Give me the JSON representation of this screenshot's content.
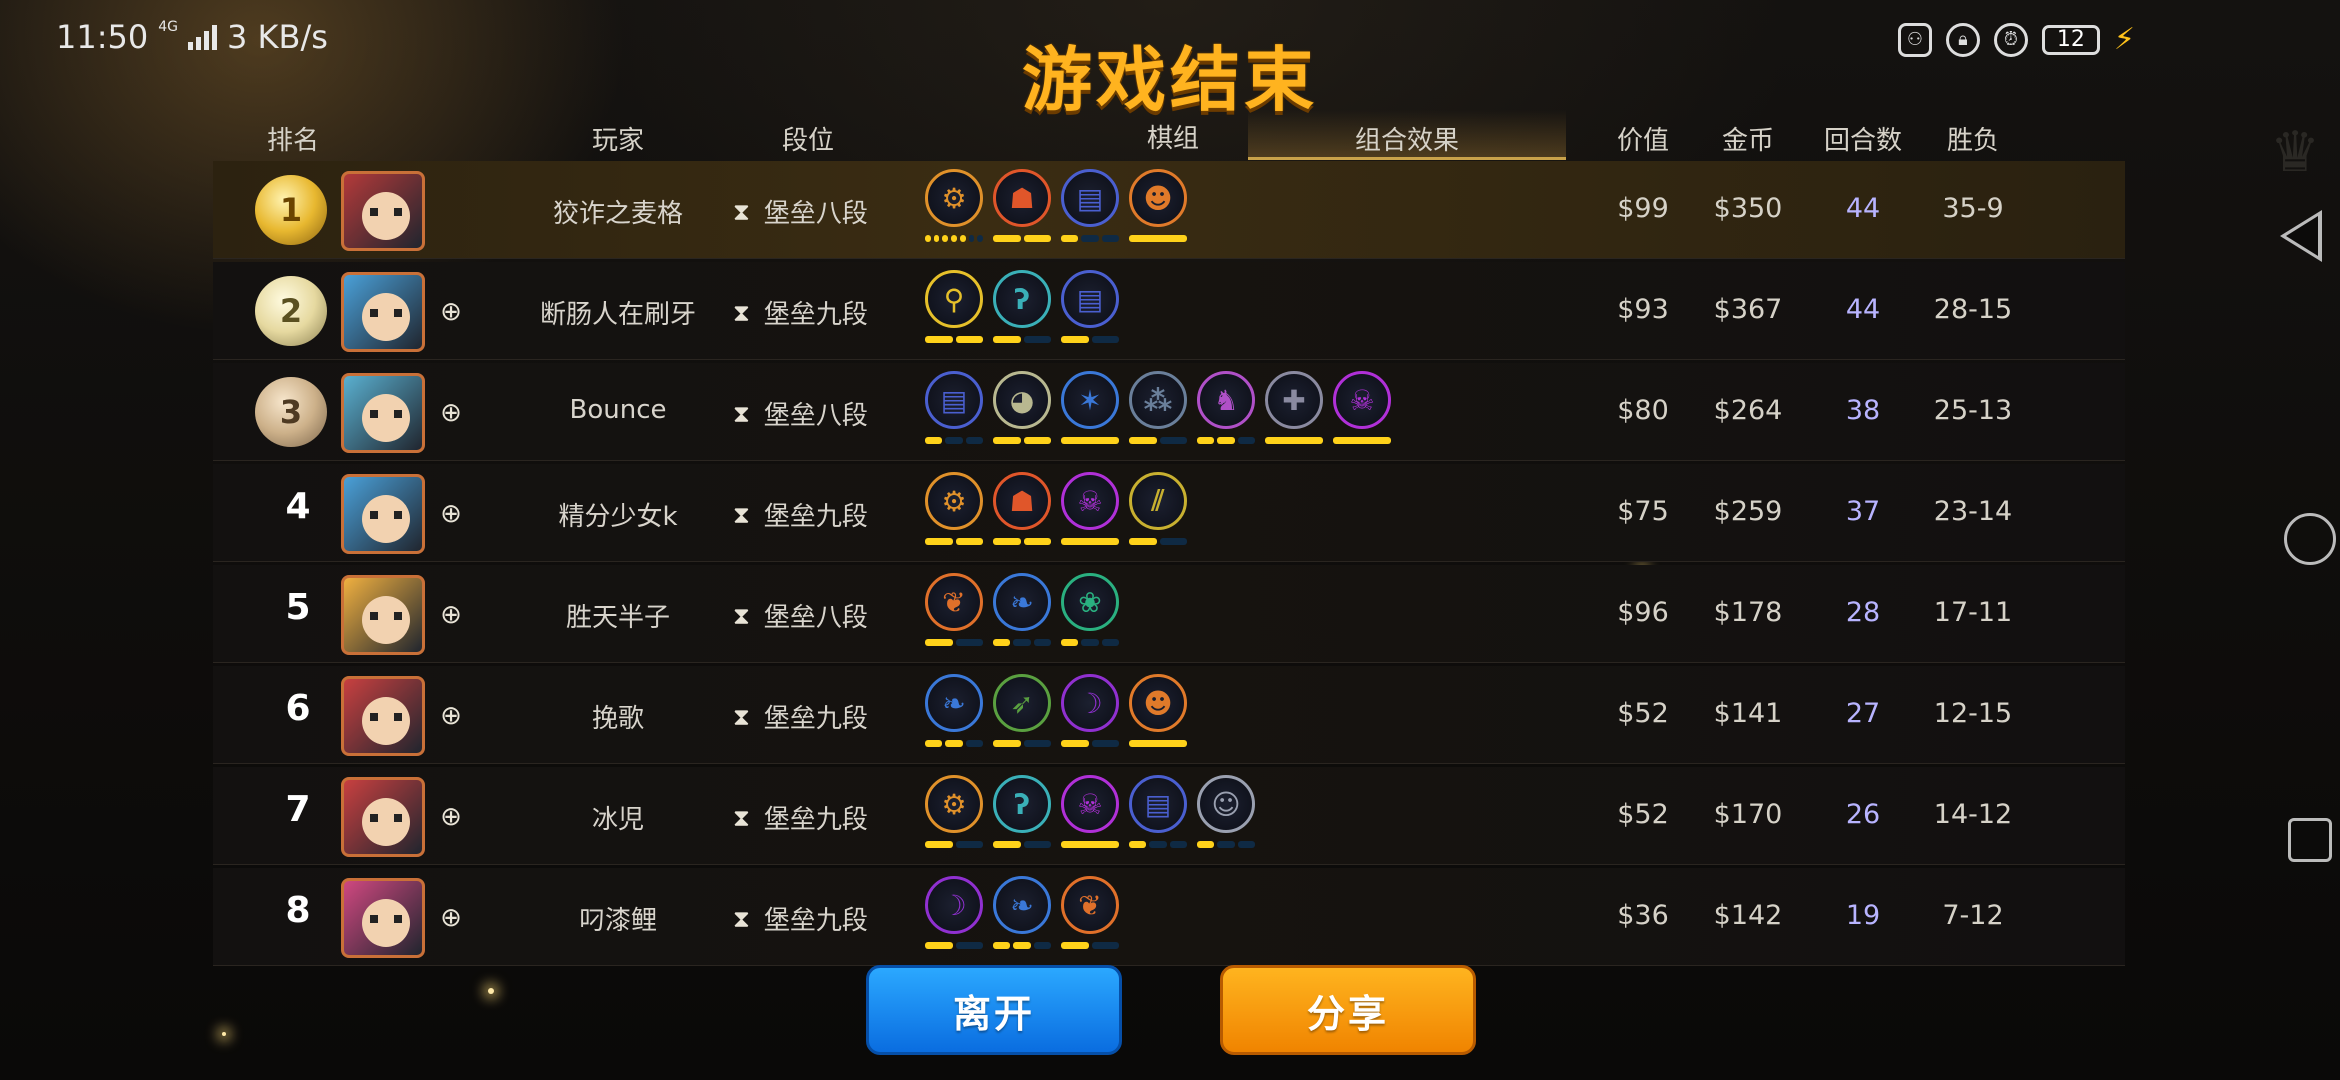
{
  "status_bar": {
    "time": "11:50",
    "network": "4G",
    "speed": "3 KB/s",
    "battery": "12",
    "icons": [
      "game-controller-icon",
      "lock-rotation-icon",
      "alarm-icon"
    ]
  },
  "title": "游戏结束",
  "columns": {
    "rank": "排名",
    "player": "玩家",
    "tier": "段位",
    "board": "棋组",
    "synergy": "组合效果",
    "value": "价值",
    "gold": "金币",
    "rounds": "回合数",
    "record": "胜负"
  },
  "players": [
    {
      "rank": "1",
      "medal": "gold",
      "name": "狡诈之麦格",
      "tier": "堡垒八段",
      "value": "$99",
      "gold": "$350",
      "rounds": "44",
      "record": "35-9",
      "avatar_color": "#b33a3a",
      "self": true,
      "synergies": [
        {
          "icon": "gear-icon",
          "color": "#e0912a",
          "bars": [
            1,
            1,
            1,
            1,
            1,
            0,
            0
          ]
        },
        {
          "icon": "orc-icon",
          "color": "#e0562a",
          "bars": [
            1,
            1
          ]
        },
        {
          "icon": "book-icon",
          "color": "#4a5fd0",
          "bars": [
            1,
            0,
            0
          ]
        },
        {
          "icon": "viking-icon",
          "color": "#e07a2a",
          "bars": [
            1
          ]
        }
      ]
    },
    {
      "rank": "2",
      "medal": "silver",
      "name": "断肠人在刷牙",
      "tier": "堡垒九段",
      "value": "$93",
      "gold": "$367",
      "rounds": "44",
      "record": "28-15",
      "avatar_color": "#4aa0d8",
      "self": false,
      "synergies": [
        {
          "icon": "keyhole-icon",
          "color": "#e6c02a",
          "bars": [
            1,
            1
          ]
        },
        {
          "icon": "hook-icon",
          "color": "#3ab0b8",
          "bars": [
            1,
            0
          ]
        },
        {
          "icon": "book-icon",
          "color": "#4a5fd0",
          "bars": [
            1,
            0
          ]
        }
      ]
    },
    {
      "rank": "3",
      "medal": "bronze",
      "name": "Bounce",
      "tier": "堡垒八段",
      "value": "$80",
      "gold": "$264",
      "rounds": "38",
      "record": "25-13",
      "avatar_color": "#5ab0d0",
      "self": false,
      "synergies": [
        {
          "icon": "book-icon",
          "color": "#4a5fd0",
          "bars": [
            1,
            0,
            0
          ]
        },
        {
          "icon": "penguin-icon",
          "color": "#b8b890",
          "bars": [
            1,
            1
          ]
        },
        {
          "icon": "shatter-icon",
          "color": "#3a78d8",
          "bars": [
            1
          ]
        },
        {
          "icon": "spirits-icon",
          "color": "#6a7f9a",
          "bars": [
            1,
            0
          ]
        },
        {
          "icon": "knight-icon",
          "color": "#b050c8",
          "bars": [
            1,
            1,
            0
          ]
        },
        {
          "icon": "cross-icon",
          "color": "#8a8aa0",
          "bars": [
            1
          ]
        },
        {
          "icon": "demon-icon",
          "color": "#b030d8",
          "bars": [
            1
          ]
        }
      ]
    },
    {
      "rank": "4",
      "medal": "",
      "name": "精分少女k",
      "tier": "堡垒九段",
      "value": "$75",
      "gold": "$259",
      "rounds": "37",
      "record": "23-14",
      "avatar_color": "#4aa0d8",
      "self": false,
      "synergies": [
        {
          "icon": "gear-icon",
          "color": "#e0912a",
          "bars": [
            1,
            1
          ]
        },
        {
          "icon": "orc-icon",
          "color": "#e0562a",
          "bars": [
            1,
            1
          ]
        },
        {
          "icon": "demon-icon",
          "color": "#b030d8",
          "bars": [
            1
          ]
        },
        {
          "icon": "claws-icon",
          "color": "#c8b030",
          "bars": [
            1,
            0
          ]
        }
      ]
    },
    {
      "rank": "5",
      "medal": "",
      "name": "胜天半子",
      "tier": "堡垒八段",
      "value": "$96",
      "gold": "$178",
      "rounds": "28",
      "record": "17-11",
      "avatar_color": "#f0b040",
      "self": false,
      "synergies": [
        {
          "icon": "feather-icon",
          "color": "#e0702a",
          "bars": [
            1,
            0
          ]
        },
        {
          "icon": "wing-icon",
          "color": "#3a78d8",
          "bars": [
            1,
            0,
            0
          ]
        },
        {
          "icon": "paw-icon",
          "color": "#2ab080",
          "bars": [
            1,
            0,
            0
          ]
        }
      ]
    },
    {
      "rank": "6",
      "medal": "",
      "name": "挽歌",
      "tier": "堡垒九段",
      "value": "$52",
      "gold": "$141",
      "rounds": "27",
      "record": "12-15",
      "avatar_color": "#c84040",
      "self": false,
      "synergies": [
        {
          "icon": "wing-icon",
          "color": "#3a78d8",
          "bars": [
            1,
            1,
            0
          ]
        },
        {
          "icon": "bow-icon",
          "color": "#5aa040",
          "bars": [
            1,
            0
          ]
        },
        {
          "icon": "witch-icon",
          "color": "#9030d0",
          "bars": [
            1,
            0
          ]
        },
        {
          "icon": "viking-icon",
          "color": "#e07a2a",
          "bars": [
            1
          ]
        }
      ]
    },
    {
      "rank": "7",
      "medal": "",
      "name": "冰児",
      "tier": "堡垒九段",
      "value": "$52",
      "gold": "$170",
      "rounds": "26",
      "record": "14-12",
      "avatar_color": "#c84040",
      "self": false,
      "synergies": [
        {
          "icon": "gear-icon",
          "color": "#e0912a",
          "bars": [
            1,
            0
          ]
        },
        {
          "icon": "hook-icon",
          "color": "#3ab0b8",
          "bars": [
            1,
            0
          ]
        },
        {
          "icon": "demon-icon",
          "color": "#b030d8",
          "bars": [
            1
          ]
        },
        {
          "icon": "book-icon",
          "color": "#4a5fd0",
          "bars": [
            1,
            0,
            0
          ]
        },
        {
          "icon": "person-icon",
          "color": "#9aa0b0",
          "bars": [
            1,
            0,
            0
          ]
        }
      ]
    },
    {
      "rank": "8",
      "medal": "",
      "name": "叼漆鲤",
      "tier": "堡垒九段",
      "value": "$36",
      "gold": "$142",
      "rounds": "19",
      "record": "7-12",
      "avatar_color": "#d04880",
      "self": false,
      "synergies": [
        {
          "icon": "witch-icon",
          "color": "#9030d0",
          "bars": [
            1,
            0
          ]
        },
        {
          "icon": "wing-icon",
          "color": "#3a78d8",
          "bars": [
            1,
            1,
            0
          ]
        },
        {
          "icon": "feather-icon",
          "color": "#e0702a",
          "bars": [
            1,
            0
          ]
        }
      ]
    }
  ],
  "buttons": {
    "leave": "离开",
    "share": "分享"
  }
}
